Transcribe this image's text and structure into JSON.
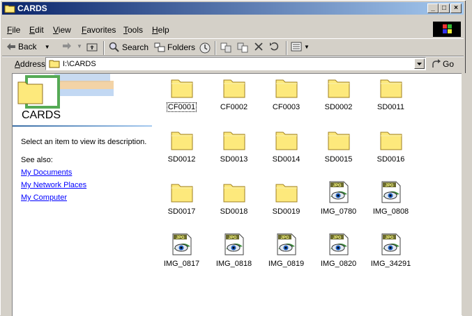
{
  "window": {
    "title": "CARDS"
  },
  "menu": [
    {
      "label": "File",
      "u": "F",
      "rest": "ile"
    },
    {
      "label": "Edit",
      "u": "E",
      "rest": "dit"
    },
    {
      "label": "View",
      "u": "V",
      "rest": "iew"
    },
    {
      "label": "Favorites",
      "u": "F",
      "rest": "avorites"
    },
    {
      "label": "Tools",
      "u": "T",
      "rest": "ools"
    },
    {
      "label": "Help",
      "u": "H",
      "rest": "elp"
    }
  ],
  "toolbar": {
    "back_label": "Back",
    "search_label": "Search",
    "folders_label": "Folders"
  },
  "address": {
    "label": "Address",
    "value": "I:\\CARDS",
    "go_label": "Go"
  },
  "sidebar": {
    "title": "CARDS",
    "description": "Select an item to view its description.",
    "see_also": "See also:",
    "links": [
      "My Documents",
      "My Network Places",
      "My Computer"
    ]
  },
  "items": [
    {
      "name": "CF0001",
      "type": "folder",
      "selected": true
    },
    {
      "name": "CF0002",
      "type": "folder"
    },
    {
      "name": "CF0003",
      "type": "folder"
    },
    {
      "name": "SD0002",
      "type": "folder"
    },
    {
      "name": "SD0011",
      "type": "folder"
    },
    {
      "name": "SD0012",
      "type": "folder"
    },
    {
      "name": "SD0013",
      "type": "folder"
    },
    {
      "name": "SD0014",
      "type": "folder"
    },
    {
      "name": "SD0015",
      "type": "folder"
    },
    {
      "name": "SD0016",
      "type": "folder"
    },
    {
      "name": "SD0017",
      "type": "folder"
    },
    {
      "name": "SD0018",
      "type": "folder"
    },
    {
      "name": "SD0019",
      "type": "folder"
    },
    {
      "name": "IMG_0780",
      "type": "jpg"
    },
    {
      "name": "IMG_0808",
      "type": "jpg"
    },
    {
      "name": "IMG_0817",
      "type": "jpg"
    },
    {
      "name": "IMG_0818",
      "type": "jpg"
    },
    {
      "name": "IMG_0819",
      "type": "jpg"
    },
    {
      "name": "IMG_0820",
      "type": "jpg"
    },
    {
      "name": "IMG_34291",
      "type": "jpg"
    }
  ],
  "jpg_badge": "JPG",
  "colors": {
    "title_start": "#0a246a",
    "title_end": "#a6caf0",
    "folder": "#fde97c",
    "link": "#0000ff"
  }
}
